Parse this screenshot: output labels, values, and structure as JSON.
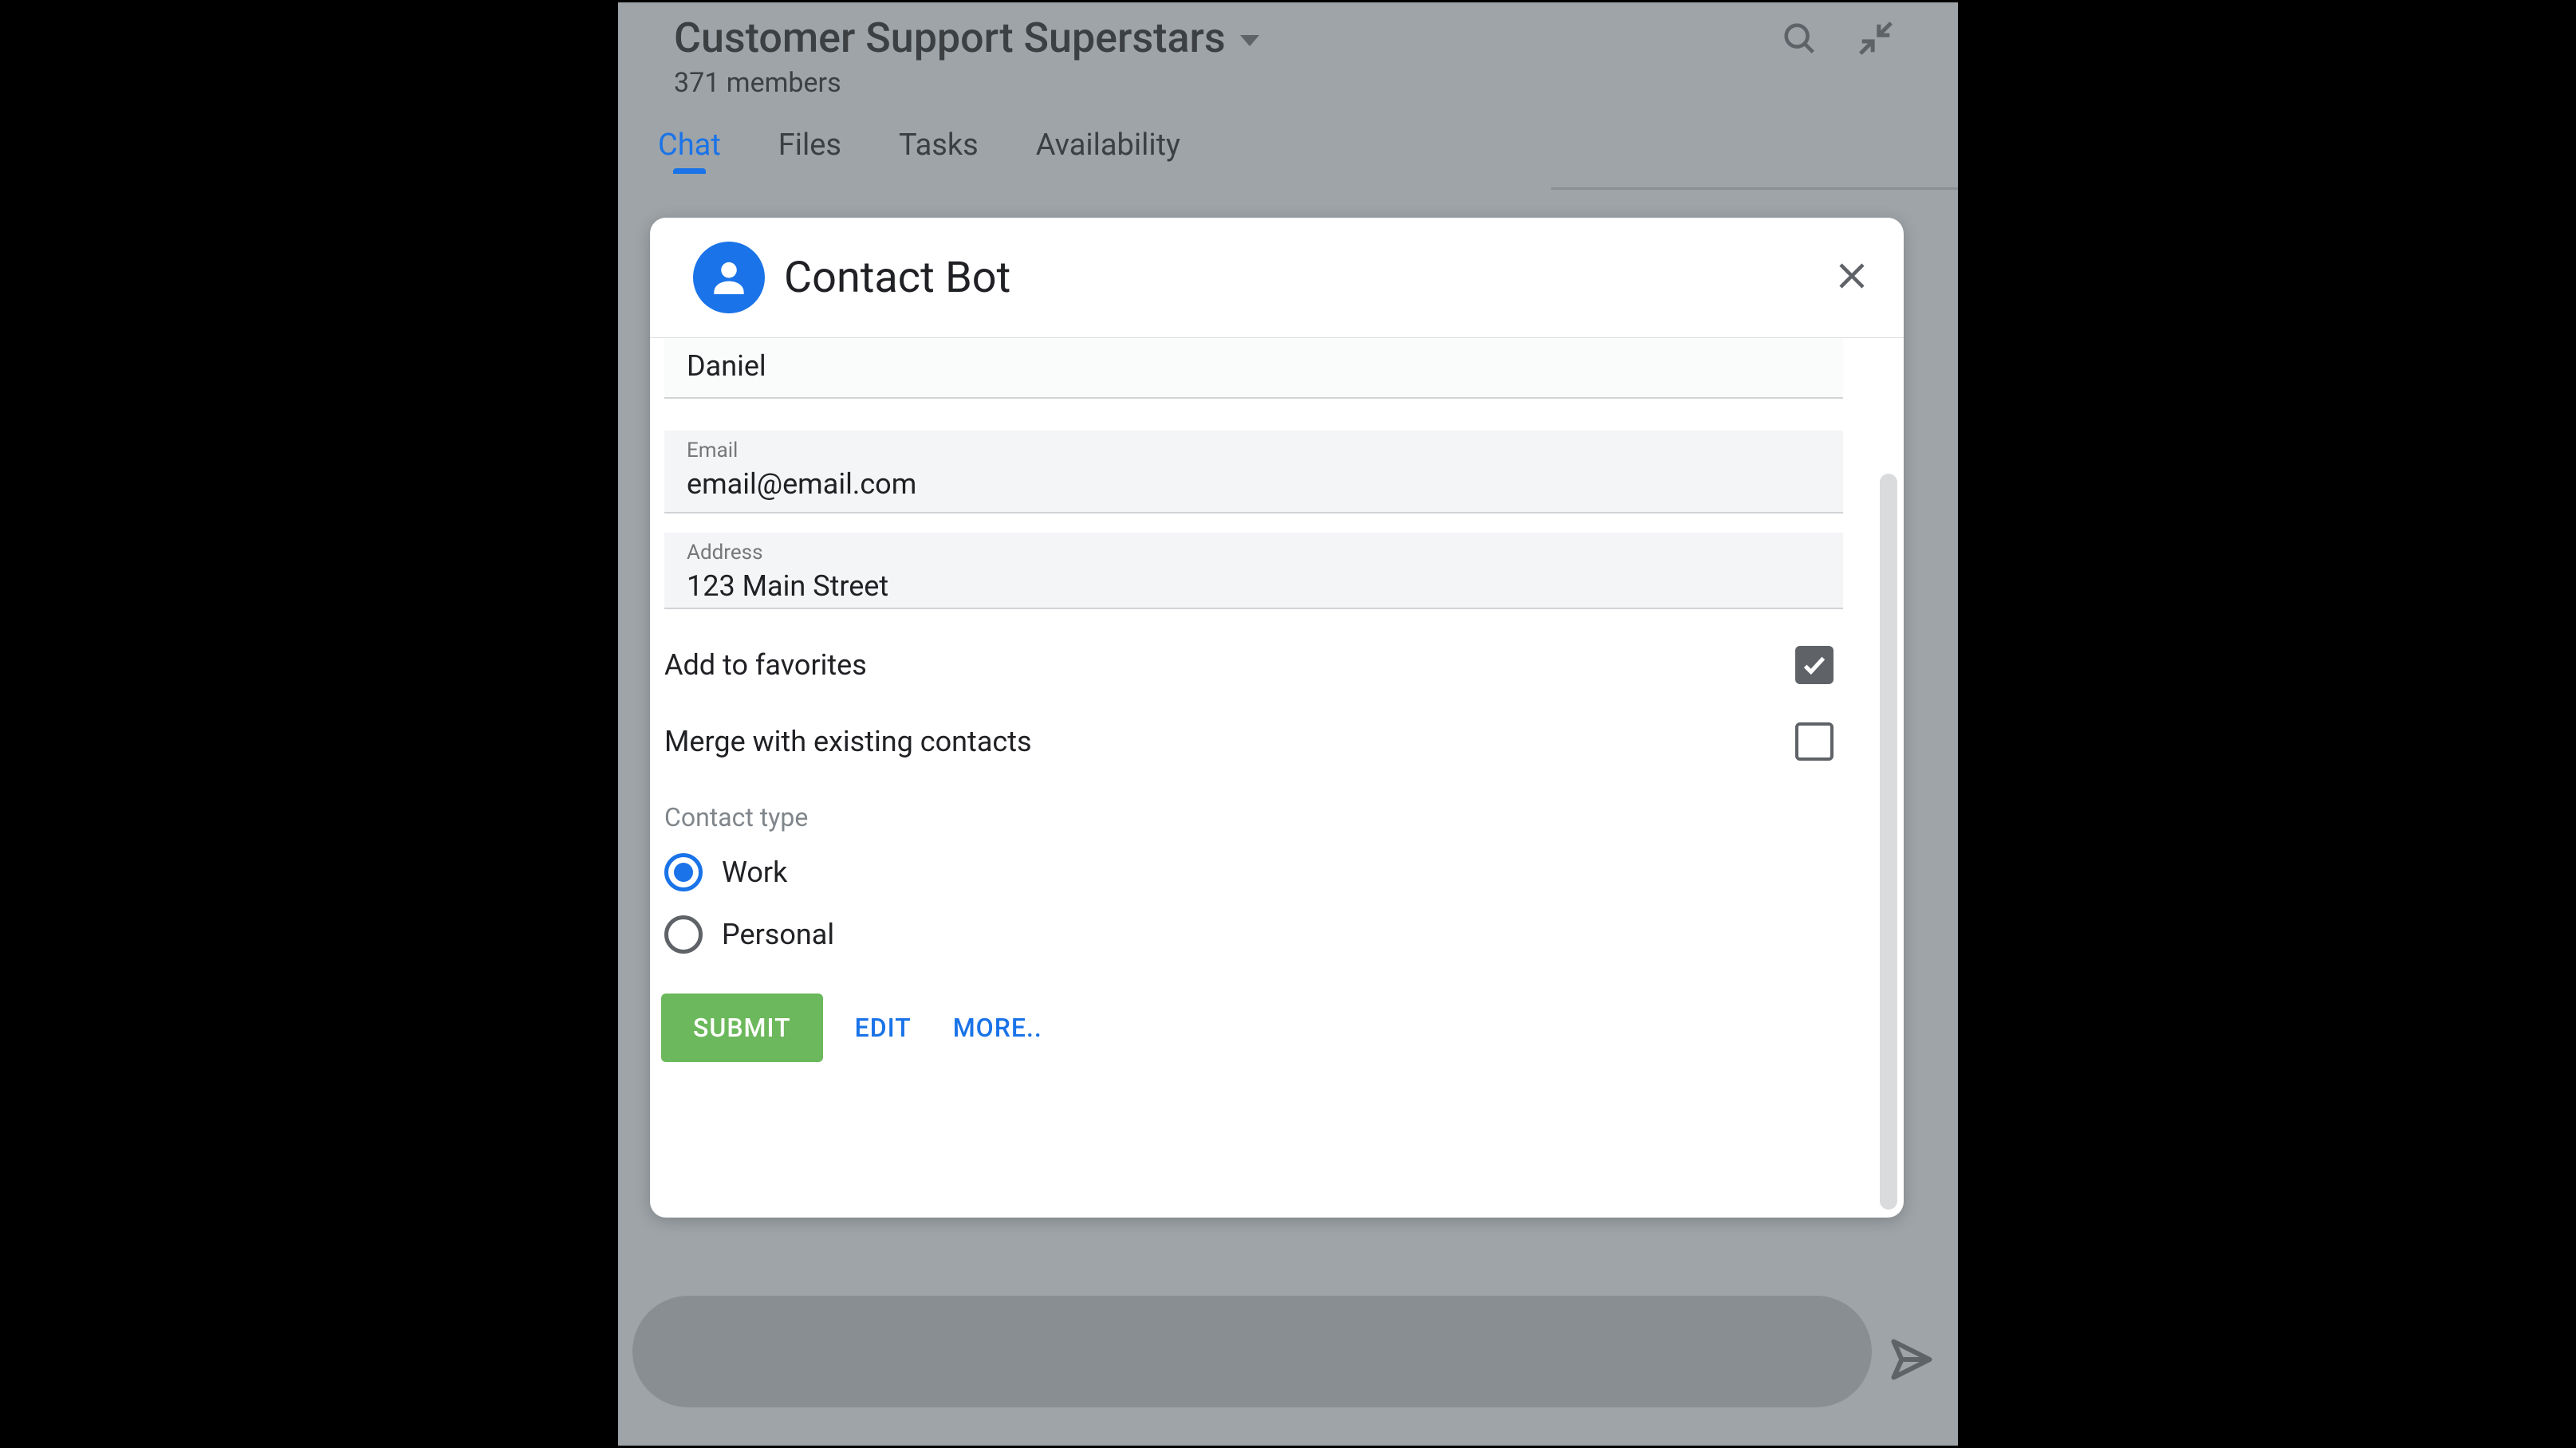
{
  "header": {
    "room_title": "Customer Support Superstars",
    "member_count": "371 members"
  },
  "tabs": {
    "chat": "Chat",
    "files": "Files",
    "tasks": "Tasks",
    "availability": "Availability"
  },
  "modal": {
    "title": "Contact Bot",
    "fields": {
      "name_value": "Daniel",
      "email_label": "Email",
      "email_value": "email@email.com",
      "address_label": "Address",
      "address_value": "123 Main Street"
    },
    "checks": {
      "favorites_label": "Add to favorites",
      "favorites_checked": true,
      "merge_label": "Merge with existing contacts",
      "merge_checked": false
    },
    "contact_type": {
      "section_label": "Contact type",
      "work_label": "Work",
      "personal_label": "Personal",
      "selected": "work"
    },
    "buttons": {
      "submit": "SUBMIT",
      "edit": "EDIT",
      "more": "MORE.."
    }
  }
}
